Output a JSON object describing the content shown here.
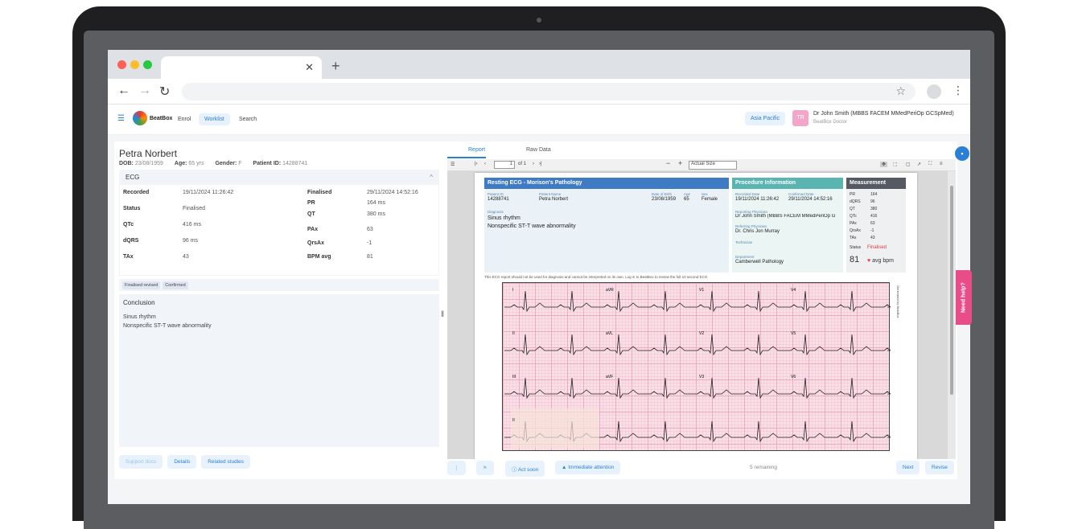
{
  "colors": {
    "accent": "#2b7fd4",
    "brand_pink": "#e84d8a",
    "report_blue": "#3f7bc4",
    "report_teal": "#5ab5b0",
    "report_dark": "#555a62"
  },
  "header": {
    "logo": "BeatBox",
    "nav": [
      "Enrol",
      "Worklist",
      "Search"
    ],
    "active_nav": "Worklist",
    "region": "Asia Pacific",
    "avatar_initials": "TR",
    "user_name": "Dr John Smith (MBBS FACEM MMedPeriOp GCSpMed)",
    "user_role": "BeatBox Doctor"
  },
  "patient": {
    "name": "Petra Norbert",
    "dob_label": "DOB:",
    "dob": "23/08/1959",
    "age_label": "Age:",
    "age": "65 yrs",
    "gender_label": "Gender:",
    "gender": "F",
    "id_label": "Patient ID:",
    "id": "14288741"
  },
  "ecg": {
    "section_title": "ECG",
    "left_fields": [
      {
        "k": "Recorded",
        "v": "19/11/2024 11:26:42"
      },
      {
        "k": "Status",
        "v": "Finalised"
      },
      {
        "k": "QTc",
        "v": "416 ms"
      },
      {
        "k": "dQRS",
        "v": "96 ms"
      },
      {
        "k": "TAx",
        "v": "43"
      }
    ],
    "right_fields": [
      {
        "k": "Finalised",
        "v": "29/11/2024 14:52:16"
      },
      {
        "k": "PR",
        "v": "164 ms"
      },
      {
        "k": "QT",
        "v": "380 ms"
      },
      {
        "k": "PAx",
        "v": "63"
      },
      {
        "k": "QrsAx",
        "v": "-1"
      },
      {
        "k": "BPM avg",
        "v": "81"
      }
    ],
    "badges": [
      "Finalised revised",
      "Confirmed"
    ]
  },
  "conclusion": {
    "title": "Conclusion",
    "lines": [
      "Sinus rhythm",
      "Nonspecific ST-T wave abnormality"
    ]
  },
  "left_footer": {
    "support_docs": "Support docs",
    "details": "Details",
    "related": "Related studies"
  },
  "right_tabs": {
    "report": "Report",
    "raw": "Raw Data"
  },
  "pdf_toolbar": {
    "page": "1",
    "of": "of 1",
    "zoom": "Actual Size"
  },
  "report": {
    "title": "Resting ECG - Morison's Pathology",
    "patient_id_label": "Patient ID",
    "patient_id": "14288741",
    "patient_name_label": "Patient Name",
    "patient_name": "Petra  Norbert",
    "dob_label": "Date of Birth",
    "dob": "23/08/1959",
    "age_label": "Age",
    "age": "65",
    "sex_label": "Sex",
    "sex": "Female",
    "diagnosis_label": "Diagnosis",
    "diagnosis": [
      "Sinus rhythm",
      "Nonspecific ST-T wave abnormality"
    ],
    "procedure_title": "Procedure Information",
    "recorded_label": "Recorded Date",
    "recorded": "19/11/2024 11:26:42",
    "confirmed_label": "Confirmed Date",
    "confirmed": "29/11/2024 14:52:16",
    "reporting_label": "Reporting Physician",
    "reporting": "Dr John Smith (MBBS FACEM MMedPeriOp G",
    "referring_label": "Referring Physician",
    "referring": "Dr. Chris Jon Murray",
    "technician_label": "Technician",
    "department_label": "Department",
    "department": "Camberwell Pathology",
    "measurement_title": "Measurement",
    "measurements": [
      {
        "k": "PR",
        "v": "164"
      },
      {
        "k": "dQRS",
        "v": "96"
      },
      {
        "k": "QT",
        "v": "380"
      },
      {
        "k": "QTc",
        "v": "416"
      },
      {
        "k": "PAx",
        "v": "63"
      },
      {
        "k": "QrsAx",
        "v": "-1"
      },
      {
        "k": "TAx",
        "v": "43"
      }
    ],
    "status_label": "Status",
    "status": "Finalised",
    "bpm": "81",
    "bpm_label": "avg bpm",
    "disclaimer": "This ECG report should not be used for diagnosis and cannot be interpreted on its own. Log in to BeatBox to review the full 10 second ECG.",
    "leads": [
      "I",
      "aVR",
      "V1",
      "V4",
      "II",
      "aVL",
      "V2",
      "V5",
      "III",
      "aVF",
      "V3",
      "V6",
      "II"
    ],
    "side_text": "Generated by BeatBox"
  },
  "right_footer": {
    "act_soon": "Act soon",
    "immediate": "Immediate attention",
    "remaining": "5 remaining",
    "next": "Next",
    "revise": "Revise"
  },
  "need_help": "Need help?"
}
